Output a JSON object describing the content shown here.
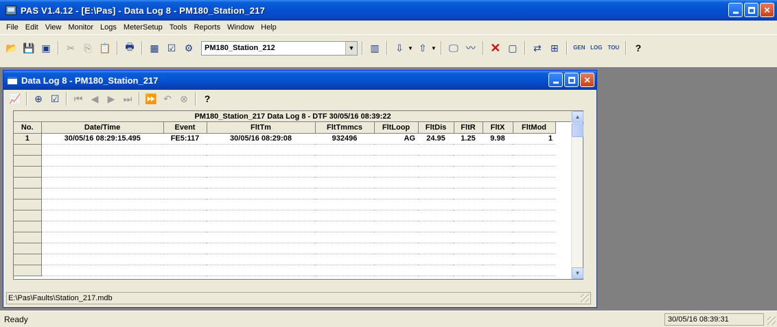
{
  "window": {
    "title": "PAS V1.4.12 - [E:\\Pas] - Data Log 8 - PM180_Station_217"
  },
  "menu": [
    "File",
    "Edit",
    "View",
    "Monitor",
    "Logs",
    "MeterSetup",
    "Tools",
    "Reports",
    "Window",
    "Help"
  ],
  "toolbar": {
    "site_combo_value": "PM180_Station_212",
    "gen_label": "GEN",
    "log_label": "LOG",
    "tou_label": "TOU"
  },
  "child": {
    "title": "Data Log 8 - PM180_Station_217",
    "grid_title": "PM180_Station_217  Data Log 8 - DTF  30/05/16 08:39:22",
    "columns": [
      "No.",
      "Date/Time",
      "Event",
      "FltTm",
      "FltTmmcs",
      "FltLoop",
      "FltDis",
      "FltR",
      "FltX",
      "FltMod"
    ],
    "rows": [
      [
        "1",
        "30/05/16 08:29:15.495",
        "FE5:117",
        "30/05/16 08:29:08",
        "932496",
        "AG",
        "24.95",
        "1.25",
        "9.98",
        "1"
      ]
    ],
    "status_path": "E:\\Pas\\Faults\\Station_217.mdb"
  },
  "status": {
    "text": "Ready",
    "datetime": "30/05/16 08:39:31"
  }
}
